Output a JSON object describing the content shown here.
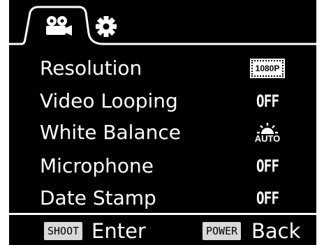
{
  "tabs": [
    {
      "icon": "video-camera-icon",
      "active": true
    },
    {
      "icon": "gear-icon",
      "active": false
    }
  ],
  "settings": [
    {
      "label": "Resolution",
      "value": "1080P",
      "kind": "badge"
    },
    {
      "label": "Video Looping",
      "value": "OFF",
      "kind": "text"
    },
    {
      "label": "White Balance",
      "value": "AUTO",
      "kind": "icon",
      "icon": "sun-auto-icon"
    },
    {
      "label": "Microphone",
      "value": "OFF",
      "kind": "text"
    },
    {
      "label": "Date Stamp",
      "value": "OFF",
      "kind": "text"
    }
  ],
  "footer": {
    "shoot_key": "SHOOT",
    "shoot_action": "Enter",
    "power_key": "POWER",
    "power_action": "Back"
  }
}
